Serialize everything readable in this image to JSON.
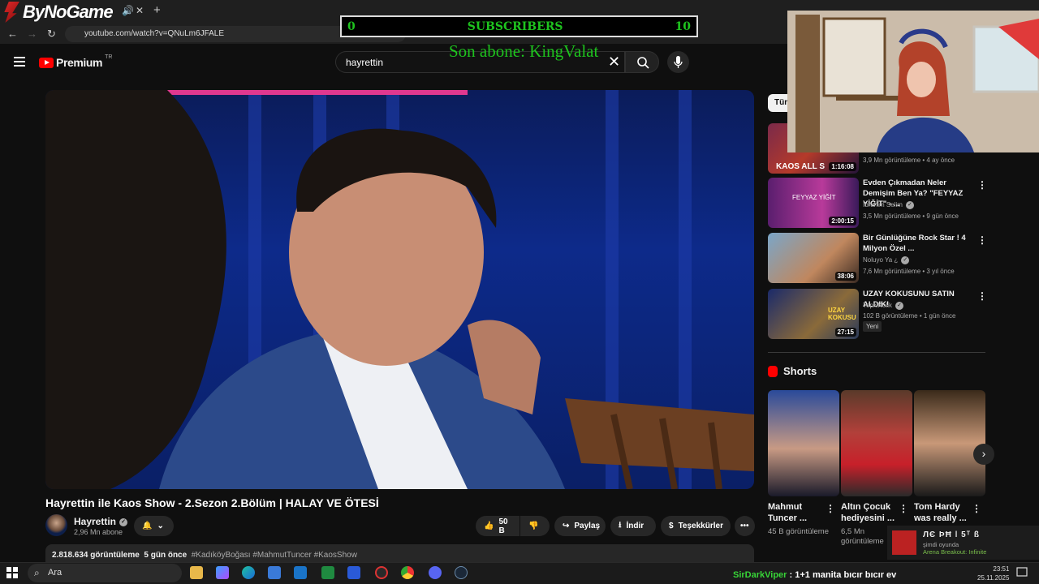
{
  "browser": {
    "brand": "ByNoGame",
    "url": "youtube.com/watch?v=QNuLm6JFALE"
  },
  "overlay": {
    "sub_left": "0",
    "sub_label": "SUBSCRIBERS",
    "sub_right": "10",
    "last_sub": "Son abone: KingValat"
  },
  "youtube": {
    "logo": "Premium",
    "region": "TR",
    "search_value": "hayrettin"
  },
  "video": {
    "title": "Hayrettin ile Kaos Show - 2.Sezon 2.Bölüm | HALAY VE ÖTESİ",
    "channel": "Hayrettin",
    "subscribers": "2,96 Mn abone",
    "likes": "50 B",
    "share": "Paylaş",
    "download": "İndir",
    "thanks": "Teşekkürler",
    "views": "2.818.634 görüntüleme",
    "age": "5 gün önce",
    "tags": "#KadıköyBoğası #MahmutTuncer #KaosShow"
  },
  "sidebar": {
    "chip": "Tüm",
    "recs": [
      {
        "title": "",
        "channel": "",
        "meta": "3,9 Mn görüntüleme • 4 ay önce",
        "duration": "1:16:08",
        "thumb_text": "KAOS ALL S"
      },
      {
        "title": "Evden Çıkmadan Neler Demişim Ben Ya? \"FEYYAZ YİĞİT\" - ...",
        "channel": "İbrahim Selim",
        "meta": "3,5 Mn görüntüleme • 9 gün önce",
        "duration": "2:00:15",
        "thumb_text": "FEYYAZ YİĞİT"
      },
      {
        "title": "Bir Günlüğüne Rock Star ! 4 Milyon Özel ...",
        "channel": "Noluyo Ya ¿",
        "meta": "7,6 Mn görüntüleme • 3 yıl önce",
        "duration": "38:06",
        "thumb_text": ""
      },
      {
        "title": "UZAY KOKUSUNU SATIN ALDIK!",
        "channel": "TepkiKolik",
        "meta": "102 B görüntüleme • 1 gün önce",
        "duration": "27:15",
        "badge": "Yeni",
        "thumb_text": "UZAY KOKUSU"
      }
    ],
    "shorts_title": "Shorts",
    "shorts": [
      {
        "title": "Mahmut Tuncer ...",
        "views": "45 B görüntüleme"
      },
      {
        "title": "Altın Çocuk hediyesini ...",
        "views": "6,5 Mn görüntüleme"
      },
      {
        "title": "Tom Hardy was really ...",
        "views": ""
      }
    ]
  },
  "notification": {
    "name": "ЛЄ ÞĦ ǀ 5ᵀ ß",
    "status": "şimdi oyunda",
    "game": "Arena Breakout: Infinite"
  },
  "taskbar": {
    "search": "Ara",
    "ticker_user": "SirDarkViper",
    "ticker_text": ": 1+1 manita bıcır bıcır ev",
    "time": "23:51",
    "date": "25.11.2025"
  },
  "colors": {
    "accent_green": "#1ec31e",
    "yt_red": "#ff0000",
    "bg": "#0f0f0f"
  }
}
